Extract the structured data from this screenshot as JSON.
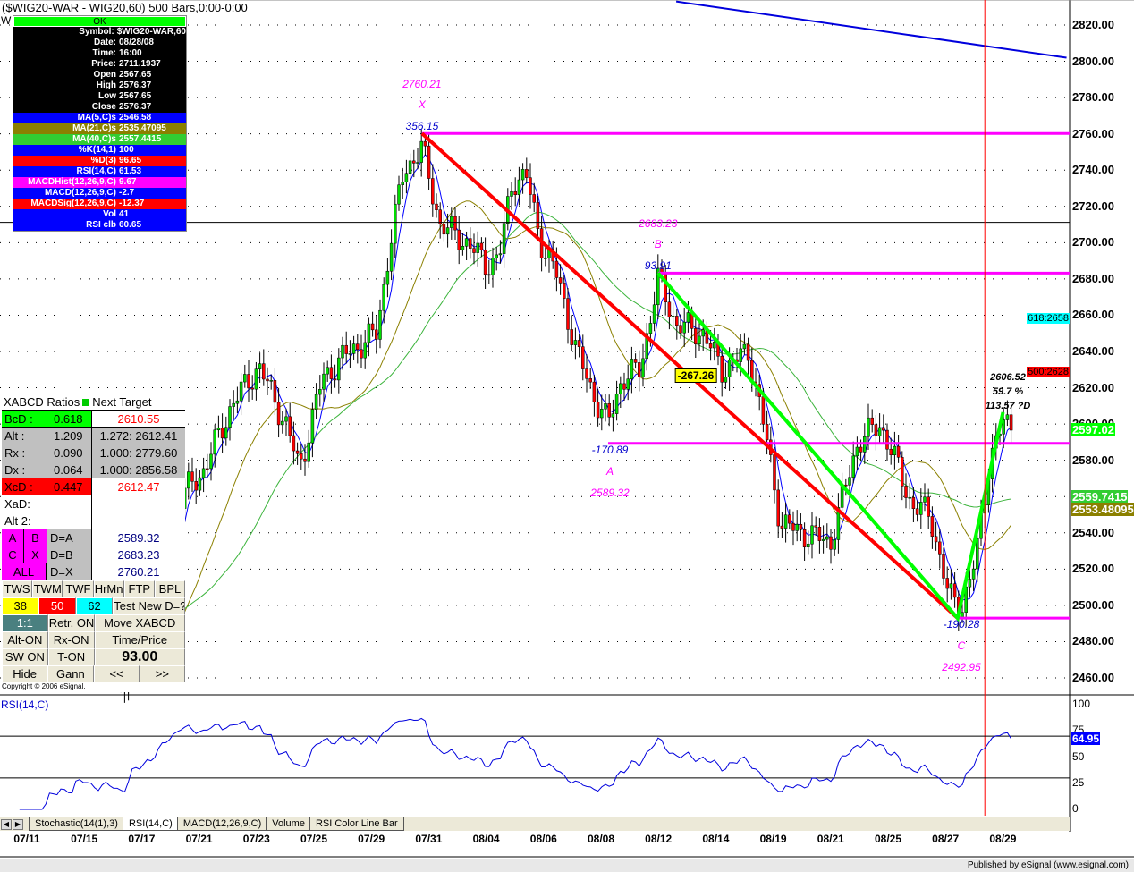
{
  "window": {
    "title": "($WIG20-WAR - WIG20,60) 500 Bars,0:00-0:00",
    "w_label": "W"
  },
  "data_window": {
    "ok": "OK",
    "rows": [
      {
        "k": "Symbol:",
        "v": "$WIG20-WAR,60",
        "bg": "#000000"
      },
      {
        "k": "Date:",
        "v": "08/28/08",
        "bg": "#000000"
      },
      {
        "k": "Time:",
        "v": "16:00",
        "bg": "#000000"
      },
      {
        "k": "Price:",
        "v": "2711.1937",
        "bg": "#000000"
      },
      {
        "k": "Open",
        "v": "2567.65",
        "bg": "#000000"
      },
      {
        "k": "High",
        "v": "2576.37",
        "bg": "#000000"
      },
      {
        "k": "Low",
        "v": "2567.65",
        "bg": "#000000"
      },
      {
        "k": "Close",
        "v": "2576.37",
        "bg": "#000000"
      },
      {
        "k": "MA(5,C)s",
        "v": "2546.58",
        "bg": "#0000ff"
      },
      {
        "k": "MA(21,C)s",
        "v": "2535.47095",
        "bg": "#8b8000"
      },
      {
        "k": "MA(40,C)s",
        "v": "2557.4415",
        "bg": "#32cd32"
      },
      {
        "k": "%K(14,1)",
        "v": "100",
        "bg": "#0000ff"
      },
      {
        "k": "%D(3)",
        "v": "96.65",
        "bg": "#ff0000"
      },
      {
        "k": "RSI(14,C)",
        "v": "61.53",
        "bg": "#0000ff"
      },
      {
        "k": "MACDHist(12,26,9,C)",
        "v": "9.67",
        "bg": "#ff00ff"
      },
      {
        "k": "MACD(12,26,9,C)",
        "v": "-2.7",
        "bg": "#0000ff"
      },
      {
        "k": "MACDSig(12,26,9,C)",
        "v": "-12.37",
        "bg": "#ff0000"
      },
      {
        "k": "Vol",
        "v": "41",
        "bg": "#0000ff"
      },
      {
        "k": "RSI clb",
        "v": "60.65",
        "bg": "#0000ff"
      }
    ]
  },
  "xabcd": {
    "header": "XABCD Ratios",
    "header2": "Next Target",
    "ratios": [
      {
        "name": "BcD :",
        "val": "0.618",
        "target": "2610.55",
        "bg": "#00ff00",
        "tbg": "#ffffff",
        "tcolor": "#ff0000"
      },
      {
        "name": "Alt  :",
        "val": "1.209",
        "target": "1.272: 2612.41",
        "bg": "#c0c0c0",
        "tbg": "#c0c0c0",
        "tcolor": "#000000"
      },
      {
        "name": "Rx  :",
        "val": "0.090",
        "target": "1.000: 2779.60",
        "bg": "#c0c0c0",
        "tbg": "#c0c0c0",
        "tcolor": "#000000"
      },
      {
        "name": "Dx  :",
        "val": "0.064",
        "target": "1.000: 2856.58",
        "bg": "#c0c0c0",
        "tbg": "#c0c0c0",
        "tcolor": "#000000"
      },
      {
        "name": "XcD :",
        "val": "0.447",
        "target": "2612.47",
        "bg": "#ff0000",
        "tbg": "#ffffff",
        "tcolor": "#ff0000"
      },
      {
        "name": "XaD:",
        "val": "",
        "target": "",
        "bg": "#ffffff",
        "tbg": "#ffffff",
        "tcolor": "#000000"
      },
      {
        "name": "Alt 2:",
        "val": "",
        "target": "",
        "bg": "#ffffff",
        "tbg": "#ffffff",
        "tcolor": "#000000"
      }
    ],
    "points": [
      {
        "a": "A",
        "b": "B",
        "eq": "D=A",
        "val": "2589.32"
      },
      {
        "a": "C",
        "b": "X",
        "eq": "D=B",
        "val": "2683.23"
      },
      {
        "a": "ALL",
        "b": "",
        "eq": "D=X",
        "val": "2760.21"
      }
    ],
    "buttons": {
      "r1": [
        "TWS",
        "TWM",
        "TWF",
        "HrMn",
        "FTP",
        "BPL"
      ],
      "r2": [
        "38",
        "50",
        "62",
        "Test New D=?"
      ],
      "r3": [
        "1:1",
        "Retr. ON",
        "Move XABCD"
      ],
      "r4": [
        "Alt-ON",
        "Rx-ON",
        "Time/Price"
      ],
      "r5": [
        "SW ON",
        "T-ON",
        "93.00"
      ],
      "r6": [
        "Hide",
        "Gann",
        "<<",
        ">>"
      ]
    },
    "copyright": "Copyright © 2006 eSignal."
  },
  "tabs": [
    "Stochastic(14(1),3)",
    "RSI(14,C)",
    "MACD(12,26,9,C)",
    "Volume",
    "RSI Color Line Bar"
  ],
  "status": "Published by eSignal (www.esignal.com)",
  "rsi_label": "RSI(14,C)",
  "chart_data": {
    "type": "candlestick",
    "ylim": [
      2450,
      2830
    ],
    "yticks": [
      "2820.00",
      "2800.00",
      "2780.00",
      "2760.00",
      "2740.00",
      "2720.00",
      "2700.00",
      "2680.00",
      "2660.00",
      "2640.00",
      "2620.00",
      "2600.00",
      "2580.00",
      "2560.00",
      "2540.00",
      "2520.00",
      "2500.00",
      "2480.00",
      "2460.00"
    ],
    "dates": [
      "07/11",
      "07/15",
      "07/17",
      "07/21",
      "07/23",
      "07/25",
      "07/29",
      "07/31",
      "08/04",
      "08/06",
      "08/08",
      "08/12",
      "08/14",
      "08/19",
      "08/21",
      "08/25",
      "08/27",
      "08/29"
    ],
    "close_pivots": [
      [
        0,
        2590
      ],
      [
        1,
        2565
      ],
      [
        4,
        2510
      ],
      [
        9,
        2500
      ],
      [
        13,
        2458
      ],
      [
        17,
        2500
      ],
      [
        19.5,
        2560
      ],
      [
        22,
        2575
      ],
      [
        25,
        2610
      ],
      [
        28,
        2632
      ],
      [
        31,
        2600
      ],
      [
        32.5,
        2575
      ],
      [
        35,
        2625
      ],
      [
        38,
        2640
      ],
      [
        41,
        2650
      ],
      [
        42.5,
        2700
      ],
      [
        44,
        2740
      ],
      [
        46,
        2752
      ],
      [
        48,
        2710
      ],
      [
        51,
        2700
      ],
      [
        53,
        2688
      ],
      [
        54.5,
        2692
      ],
      [
        56,
        2735
      ],
      [
        57.5,
        2736
      ],
      [
        59,
        2702
      ],
      [
        61,
        2680
      ],
      [
        63,
        2640
      ],
      [
        65,
        2615
      ],
      [
        66.5,
        2600
      ],
      [
        68,
        2625
      ],
      [
        70,
        2630
      ],
      [
        72,
        2680
      ],
      [
        74,
        2655
      ],
      [
        77,
        2650
      ],
      [
        79,
        2630
      ],
      [
        82,
        2640
      ],
      [
        84,
        2590
      ],
      [
        85.5,
        2545
      ],
      [
        88,
        2540
      ],
      [
        91,
        2535
      ],
      [
        94,
        2590
      ],
      [
        96.5,
        2600
      ],
      [
        98.5,
        2575
      ],
      [
        100,
        2555
      ],
      [
        102,
        2550
      ],
      [
        104,
        2505
      ],
      [
        105.5,
        2500
      ],
      [
        107,
        2525
      ],
      [
        108.5,
        2580
      ],
      [
        110,
        2600
      ],
      [
        111,
        2600
      ]
    ],
    "ma_periods": [
      5,
      21,
      40
    ],
    "ma_colors": [
      "#0000ff",
      "#8b8000",
      "#3cb43c"
    ],
    "pattern": {
      "X": {
        "bar": 46,
        "price": 2760.21,
        "label": "2760.21",
        "ratio": "356.15"
      },
      "A": {
        "bar": 66.5,
        "price": 2589.32,
        "label": "2589.32",
        "ratio": "-170.89"
      },
      "B": {
        "bar": 72,
        "price": 2683.23,
        "label": "2683.23",
        "ratio": "93.91"
      },
      "C": {
        "bar": 105,
        "price": 2492.95,
        "label": "2492.95",
        "ratio": "-190.28"
      },
      "D": {
        "bar": 110,
        "price": 2606.52,
        "label": "2606.52",
        "pct": "59.7 %",
        "note": "113.57 ?D"
      },
      "box": "-267.26"
    },
    "trendline": [
      [
        74,
        2833
      ],
      [
        117,
        2802
      ]
    ],
    "hline": 2711.19,
    "cursor_bar": 108,
    "price_tags": [
      {
        "text": "618:2658",
        "price": 2658,
        "bg": "#00ffff",
        "color": "#000000"
      },
      {
        "text": "500:2628",
        "price": 2628,
        "bg": "#ff0000",
        "color": "#000000"
      },
      {
        "text": "2597.02",
        "price": 2597,
        "bg": "#00ff00",
        "color": "#ffffff"
      },
      {
        "text": "2559.7415",
        "price": 2560,
        "bg": "#32cd32",
        "color": "#ffffff"
      },
      {
        "text": "2553.48095",
        "price": 2553,
        "bg": "#8b8000",
        "color": "#ffffff"
      }
    ],
    "rsi": {
      "ylim": [
        0,
        100
      ],
      "yticks": [
        "100",
        "75",
        "50",
        "25",
        "0"
      ],
      "last": "64.95",
      "levels": [
        70,
        30
      ]
    }
  }
}
